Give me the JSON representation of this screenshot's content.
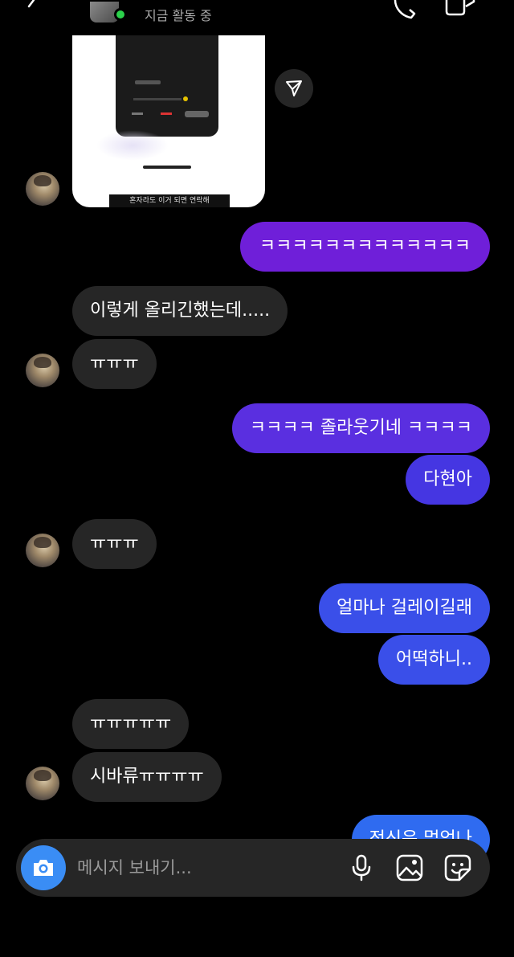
{
  "header": {
    "status": "지금 활동 중",
    "icons": [
      "back-icon",
      "call-icon",
      "video-call-icon"
    ]
  },
  "shared_post": {
    "caption": "혼자라도 이거 되면 연락해"
  },
  "messages": [
    {
      "side": "out",
      "text": "ㅋㅋㅋㅋㅋㅋㅋㅋㅋㅋㅋㅋㅋ"
    },
    {
      "side": "in",
      "text": "이렇게  올리긴했는데....."
    },
    {
      "side": "in",
      "text": "ㅠㅠㅠ"
    },
    {
      "side": "out",
      "text": "ㅋㅋㅋㅋ 졸라웃기네 ㅋㅋㅋㅋ"
    },
    {
      "side": "out",
      "text": "다현아"
    },
    {
      "side": "in",
      "text": "ㅠㅠㅠ"
    },
    {
      "side": "out",
      "text": "얼마나 걸레이길래"
    },
    {
      "side": "out",
      "text": "어떡하니.."
    },
    {
      "side": "in",
      "text": "ㅠㅠㅠㅠㅠ"
    },
    {
      "side": "in",
      "text": "시바류ㅠㅠㅠㅠ"
    },
    {
      "side": "out",
      "text": "정신은 멀었나"
    }
  ],
  "composer": {
    "placeholder": "메시지 보내기...",
    "icons": [
      "camera-icon",
      "microphone-icon",
      "gallery-icon",
      "sticker-icon"
    ]
  },
  "colors": {
    "background": "#000000",
    "incoming_bubble": "#262626",
    "outgoing_purple": "#6f1fd9",
    "outgoing_blue": "#3a4fe9",
    "camera_button": "#3a8df5",
    "online": "#2bd14b"
  }
}
